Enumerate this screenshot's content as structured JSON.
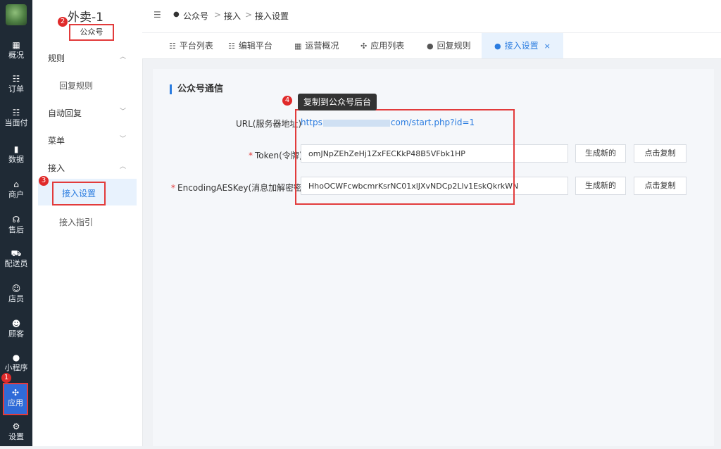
{
  "rail": {
    "items": [
      {
        "icon": "▦",
        "label": "概况"
      },
      {
        "icon": "☷",
        "label": "订单"
      },
      {
        "icon": "☷",
        "label": "当面付"
      },
      {
        "icon": "▮",
        "label": "数据"
      },
      {
        "icon": "⌂",
        "label": "商户"
      },
      {
        "icon": "☊",
        "label": "售后"
      },
      {
        "icon": "⛟",
        "label": "配送员"
      },
      {
        "icon": "☺",
        "label": "店员"
      },
      {
        "icon": "☻",
        "label": "顾客"
      },
      {
        "icon": "●",
        "label": "小程序"
      },
      {
        "icon": "✣",
        "label": "应用"
      },
      {
        "icon": "⚙",
        "label": "设置"
      }
    ],
    "active_badge": "1"
  },
  "subnav": {
    "title": "外卖-1",
    "subtitle": "公众号",
    "subtitle_badge": "2",
    "groups": [
      {
        "label": "规则",
        "chevron": "︿"
      },
      {
        "label": "自动回复",
        "chevron": "﹀"
      },
      {
        "label": "菜单",
        "chevron": "﹀"
      },
      {
        "label": "接入",
        "chevron": "︿"
      }
    ],
    "items": {
      "reply_rules": "回复规则",
      "access_settings": "接入设置",
      "access_guide": "接入指引"
    },
    "active_badge": "3"
  },
  "topbar": {
    "menu_icon": "☰",
    "crumb_icon": "●",
    "crumbs": [
      "公众号",
      "接入",
      "接入设置"
    ],
    "sep": ">"
  },
  "tabs": [
    {
      "icon": "☷",
      "label": "平台列表"
    },
    {
      "icon": "☷",
      "label": "编辑平台"
    },
    {
      "icon": "▦",
      "label": "运营概况"
    },
    {
      "icon": "✣",
      "label": "应用列表"
    },
    {
      "icon": "●",
      "label": "回复规则"
    },
    {
      "icon": "●",
      "label": "接入设置",
      "close": "×"
    }
  ],
  "content": {
    "section_title": "公众号通信",
    "url_label": "URL(服务器地址)",
    "url_prefix": "https",
    "url_suffix": "com/start.php?id=1",
    "token_label": "Token(令牌)",
    "token_value": "omJNpZEhZeHj1ZxFECKkP48B5VFbk1HP",
    "aes_label": "EncodingAESKey(消息加解密密钥)",
    "aes_value": "HhoOCWFcwbcmrKsrNC01xlJXvNDCp2Llv1EskQkrkWN",
    "required_mark": "*",
    "generate_label": "生成新的",
    "copy_label": "点击复制",
    "tooltip": "复制到公众号后台",
    "tooltip_badge": "4"
  },
  "colors": {
    "accent": "#2a7ce0",
    "annotation": "#e23b3b",
    "rail_bg": "#1f2a35"
  }
}
